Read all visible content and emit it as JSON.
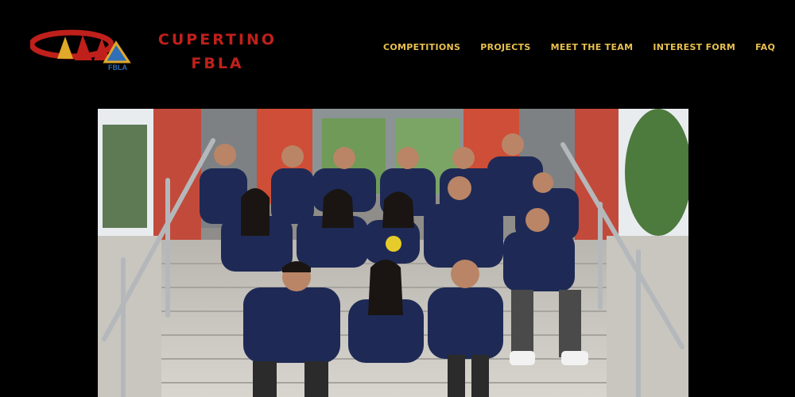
{
  "header": {
    "logo_icon": "fbla-tie-logo",
    "logo_text": "FBLA",
    "brand_line1": "CUPERTINO",
    "brand_line2": "FBLA"
  },
  "nav": {
    "items": [
      {
        "label": "COMPETITIONS"
      },
      {
        "label": "PROJECTS"
      },
      {
        "label": "MEET THE TEAM"
      },
      {
        "label": "INTEREST FORM"
      },
      {
        "label": "FAQ"
      }
    ]
  },
  "hero": {
    "image": "team-group-photo-on-stairs"
  },
  "colors": {
    "background": "#000000",
    "brand_red": "#c0201b",
    "nav_gold": "#e8c04e",
    "hoodie_navy": "#1e2a55"
  }
}
